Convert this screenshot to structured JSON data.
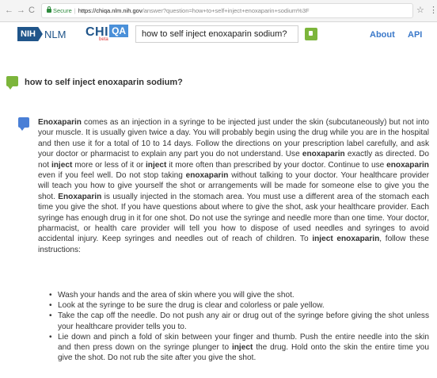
{
  "browser": {
    "back_glyph": "←",
    "forward_glyph": "→",
    "reload_glyph": "C",
    "secure_label": "Secure",
    "url_host": "https://chiqa.nlm.nih.gov",
    "url_path": "/answer?question=how+to+self+inject+enoxaparin+sodium%3F",
    "star_glyph": "☆",
    "menu_glyph": "⋮"
  },
  "header": {
    "nih_label": "NIH",
    "nlm_label": "NLM",
    "chi_label": "CHI",
    "qa_label": "QA",
    "beta_label": "beta",
    "search_value": "how to self inject enoxaparin sodium?",
    "nav_about": "About",
    "nav_api": "API"
  },
  "question": {
    "text": "how to self inject enoxaparin sodium?"
  },
  "answer": {
    "segments": [
      {
        "t": "Enoxaparin",
        "b": true
      },
      {
        "t": " comes as an injection in a syringe to be injected just under the skin (subcutaneously) but not into your muscle. It is usually given twice a day. You will probably begin using the drug while you are in the hospital and then use it for a total of 10 to 14 days. Follow the directions on your prescription label carefully, and ask your doctor or pharmacist to explain any part you do not understand. Use ",
        "b": false
      },
      {
        "t": "enoxaparin",
        "b": true
      },
      {
        "t": " exactly as directed. Do not ",
        "b": false
      },
      {
        "t": "inject",
        "b": true
      },
      {
        "t": " more or less of it or ",
        "b": false
      },
      {
        "t": "inject",
        "b": true
      },
      {
        "t": " it more often than prescribed by your doctor. Continue to use ",
        "b": false
      },
      {
        "t": "enoxaparin",
        "b": true
      },
      {
        "t": " even if you feel well. Do not stop taking ",
        "b": false
      },
      {
        "t": "enoxaparin",
        "b": true
      },
      {
        "t": " without talking to your doctor. Your healthcare provider will teach you how to give yourself the shot or arrangements will be made for someone else to give you the shot. ",
        "b": false
      },
      {
        "t": "Enoxaparin",
        "b": true
      },
      {
        "t": " is usually injected in the stomach area. You must use a different area of the stomach each time you give the shot. If you have questions about where to give the shot, ask your healthcare provider. Each syringe has enough drug in it for one shot. Do not use the syringe and needle more than one time. Your doctor, pharmacist, or health care provider will tell you how to dispose of used needles and syringes to avoid accidental injury. Keep syringes and needles out of reach of children. To ",
        "b": false
      },
      {
        "t": "inject enoxaparin",
        "b": true
      },
      {
        "t": ", follow these instructions:",
        "b": false
      }
    ],
    "bullets": [
      [
        {
          "t": "Wash your hands and the area of skin where you will give the shot.",
          "b": false
        }
      ],
      [
        {
          "t": "Look at the syringe to be sure the drug is clear and colorless or pale yellow.",
          "b": false
        }
      ],
      [
        {
          "t": "Take the cap off the needle. Do not push any air or drug out of the syringe before giving the shot unless your healthcare provider tells you to.",
          "b": false
        }
      ],
      [
        {
          "t": "Lie down and pinch a fold of skin between your finger and thumb. Push the entire needle into the skin and then press down on the syringe plunger to ",
          "b": false
        },
        {
          "t": "inject",
          "b": true
        },
        {
          "t": " the drug. Hold onto the skin the entire time you give the shot. Do not rub the site after you give the shot.",
          "b": false
        }
      ]
    ]
  },
  "colors": {
    "nih_blue": "#20558a",
    "qa_blue": "#4a90d9",
    "link_blue": "#3a78c9",
    "question_green": "#7cb53b",
    "answer_blue": "#4a7fd6",
    "secure_green": "#2e8b3d"
  },
  "icons": {
    "question_icon": "speech-bubble-green",
    "answer_icon": "speech-bubble-blue",
    "search_button_icon": "green-square-button"
  }
}
